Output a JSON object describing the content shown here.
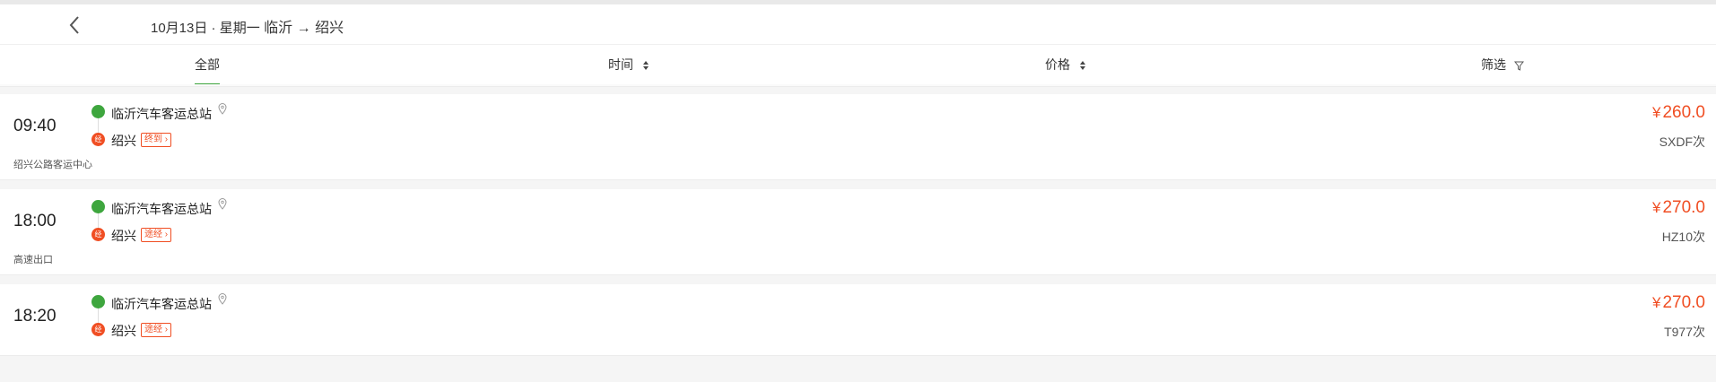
{
  "header": {
    "date": "10月13日 · 星期一",
    "from": "临沂",
    "arrow": "→",
    "to": "绍兴"
  },
  "tabs": [
    {
      "label": "全部",
      "active": true
    },
    {
      "label": "时间",
      "icon": "sort-icon"
    },
    {
      "label": "价格",
      "icon": "sort-icon"
    },
    {
      "label": "筛选",
      "icon": "filter-icon"
    }
  ],
  "trips": [
    {
      "time": "09:40",
      "start_station": "临沂汽车客运总站",
      "stop_badge": "经",
      "end_station": "绍兴",
      "end_tag": "终到",
      "price_symbol": "¥",
      "price": "260.0",
      "train_no": "SXDF次",
      "note": "绍兴公路客运中心"
    },
    {
      "time": "18:00",
      "start_station": "临沂汽车客运总站",
      "stop_badge": "经",
      "end_station": "绍兴",
      "end_tag": "途经",
      "price_symbol": "¥",
      "price": "270.0",
      "train_no": "HZ10次",
      "note": "高速出口"
    },
    {
      "time": "18:20",
      "start_station": "临沂汽车客运总站",
      "stop_badge": "经",
      "end_station": "绍兴",
      "end_tag": "途经",
      "price_symbol": "¥",
      "price": "270.0",
      "train_no": "T977次",
      "note": ""
    }
  ],
  "colors": {
    "accent_green": "#3ea63e",
    "price_red": "#f04e23"
  }
}
